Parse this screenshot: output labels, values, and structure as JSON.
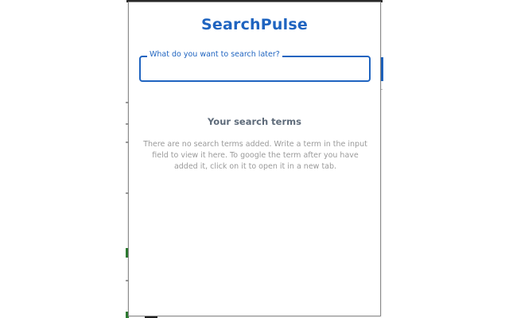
{
  "app": {
    "title": "SearchPulse"
  },
  "search": {
    "label": "What do you want to search later?",
    "value": "",
    "placeholder": ""
  },
  "terms": {
    "heading": "Your search terms",
    "empty_message": "There are no search terms added. Write a term in the input field to view it here. To google the term after you have added it, click on it to open it in a new tab.",
    "items": []
  },
  "colors": {
    "accent": "#1f64c0",
    "heading_text": "#5e6b7a",
    "muted_text": "#9a9a9a"
  }
}
